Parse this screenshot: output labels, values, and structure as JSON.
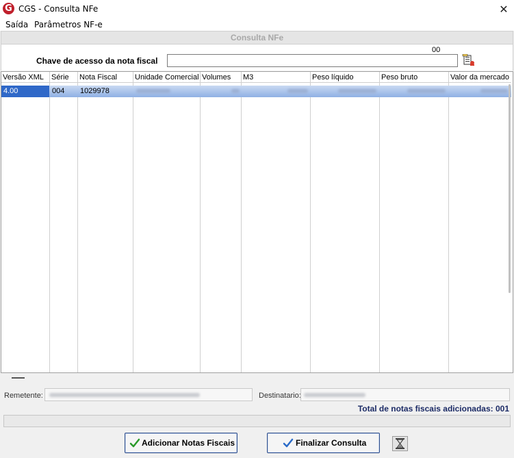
{
  "window": {
    "title": "CGS - Consulta NFe",
    "icon_letter": "G",
    "close_glyph": "✕"
  },
  "menu": {
    "items": [
      {
        "label": "Saída"
      },
      {
        "label": "Parâmetros NF-e"
      }
    ]
  },
  "section": {
    "title": "Consulta NFe"
  },
  "key": {
    "label": "Chave de acesso da nota fiscal",
    "count": "00",
    "value": ""
  },
  "grid": {
    "columns": [
      "Versão XML",
      "Série",
      "Nota Fiscal",
      "Unidade Comercial",
      "Volumes",
      "M3",
      "Peso líquido",
      "Peso bruto",
      "Valor da mercado"
    ],
    "rows": [
      {
        "versao": "4.00",
        "serie": "004",
        "nota": "1029978"
      }
    ]
  },
  "footer": {
    "remetente_label": "Remetente:",
    "destinatario_label": "Destinatario:",
    "total_text": "Total de notas fiscais adicionadas: 001"
  },
  "buttons": {
    "add_label": "Adicionar Notas Fiscais",
    "finish_label": "Finalizar Consulta"
  },
  "colors": {
    "accent": "#2f68c8",
    "brand_red": "#c0202c",
    "total_text": "#1c2b66"
  },
  "icons": [
    "app-logo-icon",
    "close-icon",
    "document-search-icon",
    "checkmark-icon",
    "hourglass-icon"
  ]
}
